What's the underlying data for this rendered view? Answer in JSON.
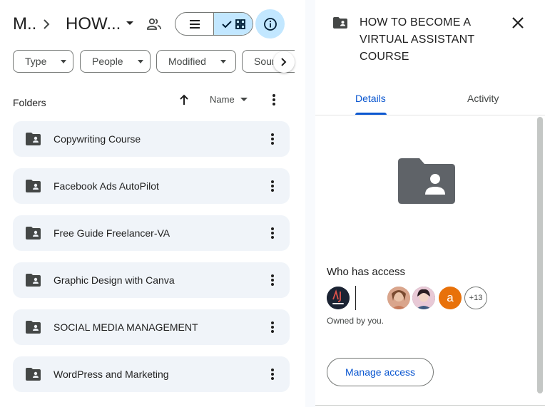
{
  "breadcrumb": {
    "parent": "M..",
    "current": "HOW..."
  },
  "filters": [
    {
      "label": "Type"
    },
    {
      "label": "People"
    },
    {
      "label": "Modified"
    },
    {
      "label": "Sour"
    }
  ],
  "list_header": {
    "section": "Folders",
    "sort_label": "Name"
  },
  "folders": [
    {
      "name": "Copywriting Course"
    },
    {
      "name": "Facebook Ads AutoPilot"
    },
    {
      "name": "Free Guide Freelancer-VA"
    },
    {
      "name": "Graphic Design with Canva"
    },
    {
      "name": "SOCIAL MEDIA MANAGEMENT"
    },
    {
      "name": "WordPress and Marketing"
    }
  ],
  "details_panel": {
    "title": "HOW TO BECOME A VIRTUAL ASSISTANT COURSE",
    "tabs": [
      {
        "label": "Details",
        "active": true
      },
      {
        "label": "Activity",
        "active": false
      }
    ],
    "who_has_access": "Who has access",
    "avatars": [
      {
        "icon": "designs-logo-avatar"
      },
      {
        "icon": "person-photo-avatar"
      },
      {
        "icon": "person-photo-avatar"
      },
      {
        "initial": "a",
        "color": "#e8710a"
      },
      {
        "overflow": "+13"
      }
    ],
    "owned_by": "Owned by you.",
    "manage_access": "Manage access"
  },
  "colors": {
    "accent": "#0b57d0",
    "selected_bg": "#c2e7ff",
    "row_bg": "#f0f4f9",
    "folder_icon": "#444746"
  }
}
